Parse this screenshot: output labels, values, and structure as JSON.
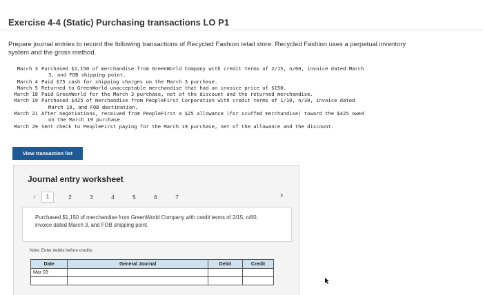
{
  "header": {
    "title": "Exercise 4-4 (Static) Purchasing transactions LO P1"
  },
  "intro": "Prepare journal entries to record the following transactions of Recycled Fashion retail store. Recycled Fashion uses a perpetual inventory system and the gross method.",
  "transactions": [
    {
      "date": "March 3",
      "lines": [
        "Purchased $1,150 of merchandise from GreenWorld Company with credit terms of 2/15, n/60, invoice dated March",
        "3, and FOB shipping point."
      ]
    },
    {
      "date": "March 4",
      "lines": [
        "Paid $75 cash for shipping charges on the March 3 purchase."
      ]
    },
    {
      "date": "March 5",
      "lines": [
        "Returned to GreenWorld unacceptable merchandise that had an invoice price of $150."
      ]
    },
    {
      "date": "March 18",
      "lines": [
        "Paid GreenWorld for the March 3 purchase, net of the discount and the returned merchandise."
      ]
    },
    {
      "date": "March 19",
      "lines": [
        "Purchased $425 of merchandise from PeopleFirst Corporation with credit terms of 1/10, n/30, invoice dated",
        "March 19, and FOB destination."
      ]
    },
    {
      "date": "March 21",
      "lines": [
        "After negotiations, received from PeopleFirst a $25 allowance (for scuffed merchandise) toward the $425 owed",
        "on the March 19 purchase."
      ]
    },
    {
      "date": "March 29",
      "lines": [
        "Sent check to PeopleFirst paying for the March 19 purchase, net of the allowance and the discount."
      ]
    }
  ],
  "buttons": {
    "view_transactions": "View transaction list"
  },
  "worksheet": {
    "title": "Journal entry worksheet",
    "pages": [
      "1",
      "2",
      "3",
      "4",
      "5",
      "6",
      "7"
    ],
    "active_page": "1",
    "description": "Purchased $1,150 of merchandise from GreenWorld Company with credit terms of 2/15, n/60, invoice dated March 3, and FOB shipping point.",
    "note": "Note: Enter debits before credits.",
    "table": {
      "headers": {
        "date": "Date",
        "account": "General Journal",
        "debit": "Debit",
        "credit": "Credit"
      },
      "rows": [
        {
          "date": "Mar 03",
          "account": "",
          "debit": "",
          "credit": ""
        },
        {
          "date": "",
          "account": "",
          "debit": "",
          "credit": ""
        }
      ]
    }
  },
  "icons": {
    "prev": "chevron-left-icon",
    "next": "chevron-right-icon"
  }
}
